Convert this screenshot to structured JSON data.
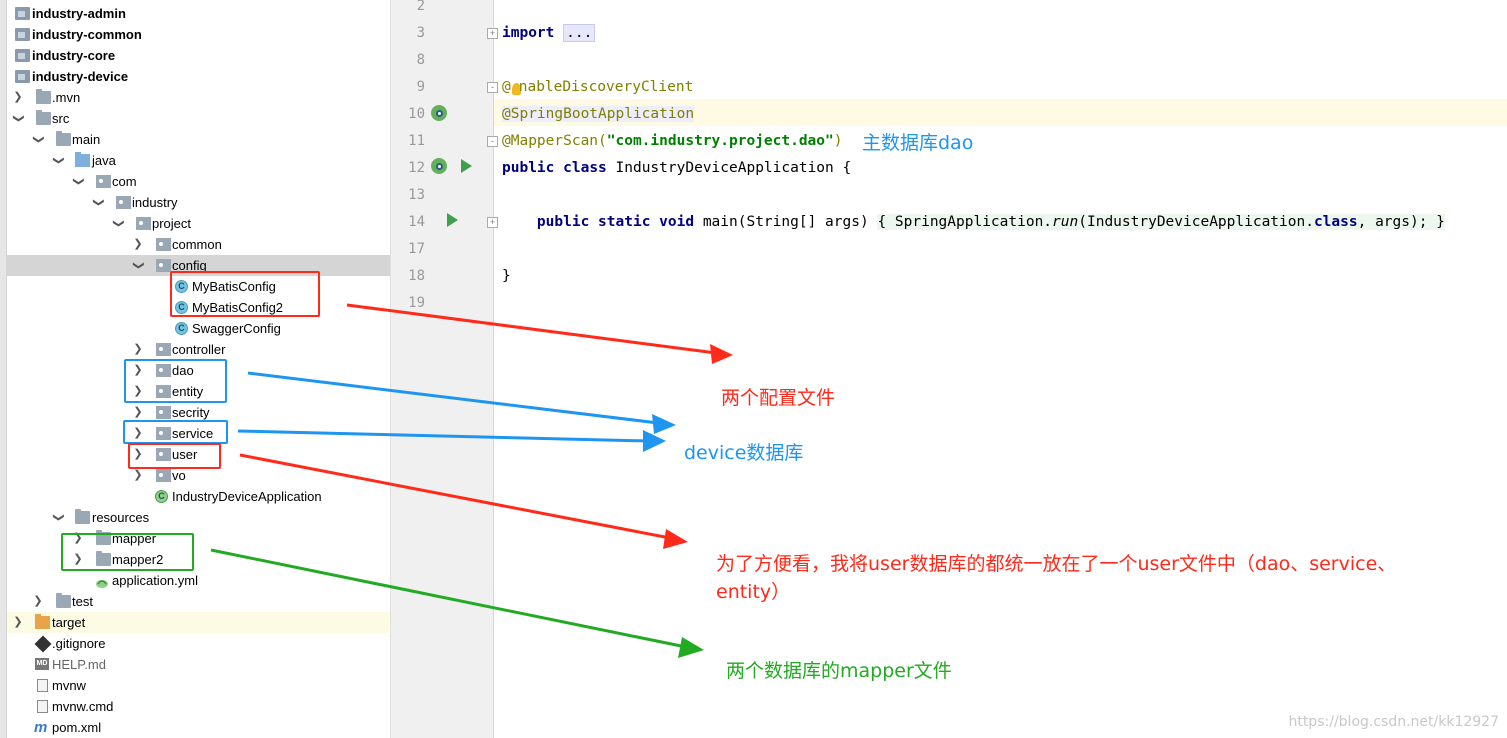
{
  "project_tree": {
    "items": [
      {
        "label": "industry-admin",
        "icon": "module-folder-icon",
        "bold": true
      },
      {
        "label": "industry-common",
        "icon": "module-folder-icon",
        "bold": true
      },
      {
        "label": "industry-core",
        "icon": "module-folder-icon",
        "bold": true
      },
      {
        "label": "industry-device",
        "icon": "module-folder-icon",
        "bold": true
      },
      {
        "label": ".mvn",
        "icon": "folder-icon"
      },
      {
        "label": "src",
        "icon": "folder-icon"
      },
      {
        "label": "main",
        "icon": "folder-icon"
      },
      {
        "label": "java",
        "icon": "source-folder-icon"
      },
      {
        "label": "com",
        "icon": "package-icon"
      },
      {
        "label": "industry",
        "icon": "package-icon"
      },
      {
        "label": "project",
        "icon": "package-icon"
      },
      {
        "label": "common",
        "icon": "package-icon"
      },
      {
        "label": "config",
        "icon": "package-icon",
        "selected": true
      },
      {
        "label": "MyBatisConfig",
        "icon": "class-icon"
      },
      {
        "label": "MyBatisConfig2",
        "icon": "class-icon"
      },
      {
        "label": "SwaggerConfig",
        "icon": "class-icon"
      },
      {
        "label": "controller",
        "icon": "package-icon"
      },
      {
        "label": "dao",
        "icon": "package-icon"
      },
      {
        "label": "entity",
        "icon": "package-icon"
      },
      {
        "label": "secrity",
        "icon": "package-icon"
      },
      {
        "label": "service",
        "icon": "package-icon"
      },
      {
        "label": "user",
        "icon": "package-icon"
      },
      {
        "label": "vo",
        "icon": "package-icon"
      },
      {
        "label": "IndustryDeviceApplication",
        "icon": "spring-boot-class-icon"
      },
      {
        "label": "resources",
        "icon": "resources-folder-icon"
      },
      {
        "label": "mapper",
        "icon": "folder-icon"
      },
      {
        "label": "mapper2",
        "icon": "folder-icon"
      },
      {
        "label": "application.yml",
        "icon": "yaml-file-icon"
      },
      {
        "label": "test",
        "icon": "folder-icon"
      },
      {
        "label": "target",
        "icon": "excluded-folder-icon"
      },
      {
        "label": ".gitignore",
        "icon": "git-icon"
      },
      {
        "label": "HELP.md",
        "icon": "markdown-icon"
      },
      {
        "label": "mvnw",
        "icon": "file-icon"
      },
      {
        "label": "mvnw.cmd",
        "icon": "file-icon"
      },
      {
        "label": "pom.xml",
        "icon": "maven-icon"
      }
    ]
  },
  "editor": {
    "line_numbers": [
      "2",
      "3",
      "8",
      "9",
      "10",
      "11",
      "12",
      "13",
      "14",
      "17",
      "18",
      "19"
    ],
    "tokens": {
      "import_kw": "import",
      "import_dots": "...",
      "ann_enable_at": "@",
      "ann_enable_rest": "nableDiscoveryClient",
      "ann_springboot": "@SpringBootApplication",
      "ann_mapperscan": "@MapperScan(",
      "mapperscan_str": "\"com.industry.project.dao\"",
      "mapperscan_close": ")",
      "kw_public": "public",
      "kw_class": "class",
      "class_name": "IndustryDeviceApplication {",
      "kw_public2": "public",
      "kw_static": "static",
      "kw_void": "void",
      "main_sig": "main(String[] args)",
      "main_body_open": "{ SpringApplication.",
      "main_run": "run",
      "main_args": "(IndustryDeviceApplication.",
      "kw_class2": "class",
      "main_tail": ", args); }",
      "closing_brace": "}"
    }
  },
  "annotations": {
    "main_db_dao": "主数据库dao",
    "two_configs": "两个配置文件",
    "device_db": "device数据库",
    "user_note_line1": "为了方便看，我将user数据库的都统一放在了一个user文件中（dao、service、",
    "user_note_line2": "entity）",
    "mapper_note": "两个数据库的mapper文件"
  },
  "colors": {
    "red": "#ff2a1a",
    "blue": "#1e96f0",
    "green": "#22aa22"
  },
  "watermark": "https://blog.csdn.net/kk12927"
}
